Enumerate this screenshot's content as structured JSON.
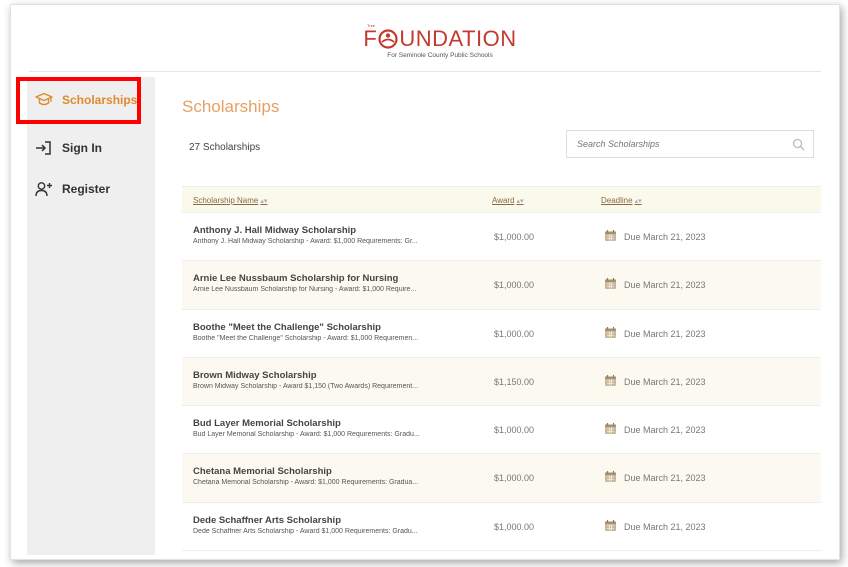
{
  "header": {
    "logo_top": "Tree",
    "logo_word_left": "F",
    "logo_word_right": "UNDATION",
    "logo_sub": "For Seminole County Public Schools"
  },
  "sidebar": {
    "items": [
      {
        "label": "Scholarships",
        "icon": "graduation-cap-icon"
      },
      {
        "label": "Sign In",
        "icon": "sign-in-icon"
      },
      {
        "label": "Register",
        "icon": "add-user-icon"
      }
    ]
  },
  "main": {
    "title": "Scholarships",
    "count": "27 Scholarships",
    "search_placeholder": "Search Scholarships"
  },
  "table": {
    "headers": {
      "name": "Scholarship Name",
      "award": "Award",
      "deadline": "Deadline",
      "sort_glyph": "▴▾"
    },
    "rows": [
      {
        "name": "Anthony J. Hall Midway Scholarship",
        "desc": "Anthony J. Hall Midway Scholarship - Award: $1,000 Requirements: Gr...",
        "award": "$1,000.00",
        "due": "Due March 21, 2023"
      },
      {
        "name": "Arnie Lee Nussbaum Scholarship for Nursing",
        "desc": "Arnie Lee Nussbaum Scholarship for Nursing - Award: $1,000 Require...",
        "award": "$1,000.00",
        "due": "Due March 21, 2023"
      },
      {
        "name": "Boothe \"Meet the Challenge\" Scholarship",
        "desc": "Boothe \"Meet the Challenge\" Scholarship - Award: $1,000 Requiremen...",
        "award": "$1,000.00",
        "due": "Due March 21, 2023"
      },
      {
        "name": "Brown Midway Scholarship",
        "desc": "Brown Midway Scholarship - Award $1,150 (Two Awards) Requirement...",
        "award": "$1,150.00",
        "due": "Due March 21, 2023"
      },
      {
        "name": "Bud Layer Memorial Scholarship",
        "desc": "Bud Layer Memorial Scholarship - Award: $1,000 Requirements: Gradu...",
        "award": "$1,000.00",
        "due": "Due March 21, 2023"
      },
      {
        "name": "Chetana Memorial Scholarship",
        "desc": "Chetana Memorial Scholarship - Award: $1,000 Requirements: Gradua...",
        "award": "$1,000.00",
        "due": "Due March 21, 2023"
      },
      {
        "name": "Dede Schaffner Arts Scholarship",
        "desc": "Dede Schaffner Arts Scholarship - Award $1,000 Requirements: Gradu...",
        "award": "$1,000.00",
        "due": "Due March 21, 2023"
      }
    ]
  },
  "colors": {
    "accent": "#e08a2e",
    "highlight": "#ff0000",
    "brand": "#c53a2f"
  }
}
